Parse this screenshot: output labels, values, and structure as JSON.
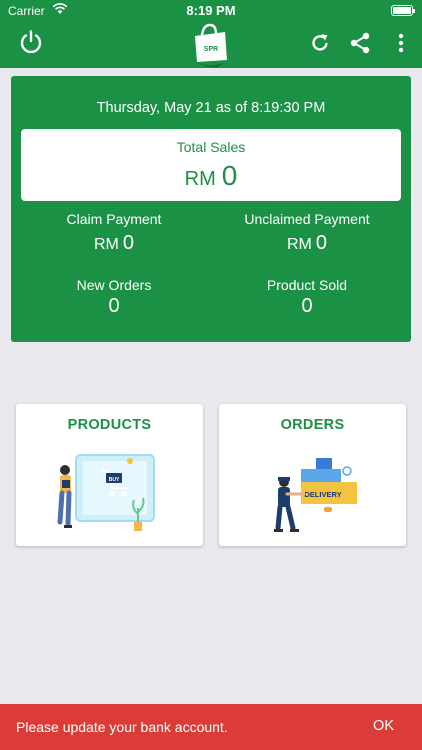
{
  "status_bar": {
    "carrier": "Carrier",
    "time": "8:19 PM"
  },
  "app_bar": {
    "icons": [
      "power-icon",
      "shopping-bag-logo",
      "refresh-icon",
      "share-icon",
      "more-vert-icon"
    ],
    "logo_text": "SPR"
  },
  "summary": {
    "as_of": "Thursday, May 21 as of 8:19:30 PM",
    "total_sales": {
      "label": "Total Sales",
      "currency": "RM",
      "value": "0"
    },
    "claim_payment": {
      "label": "Claim Payment",
      "currency": "RM",
      "value": "0"
    },
    "unclaimed_payment": {
      "label": "Unclaimed Payment",
      "currency": "RM",
      "value": "0"
    },
    "new_orders": {
      "label": "New Orders",
      "value": "0"
    },
    "product_sold": {
      "label": "Product Sold",
      "value": "0"
    }
  },
  "cards": {
    "products": {
      "title": "PRODUCTS",
      "illustration_tag": "BUY"
    },
    "orders": {
      "title": "ORDERS",
      "illustration_tag": "DELIVERY"
    }
  },
  "snackbar": {
    "message": "Please update your bank account.",
    "action": "OK"
  },
  "colors": {
    "primary": "#1b9146",
    "background": "#e8e8ed",
    "snackbar": "#dc3c38"
  }
}
